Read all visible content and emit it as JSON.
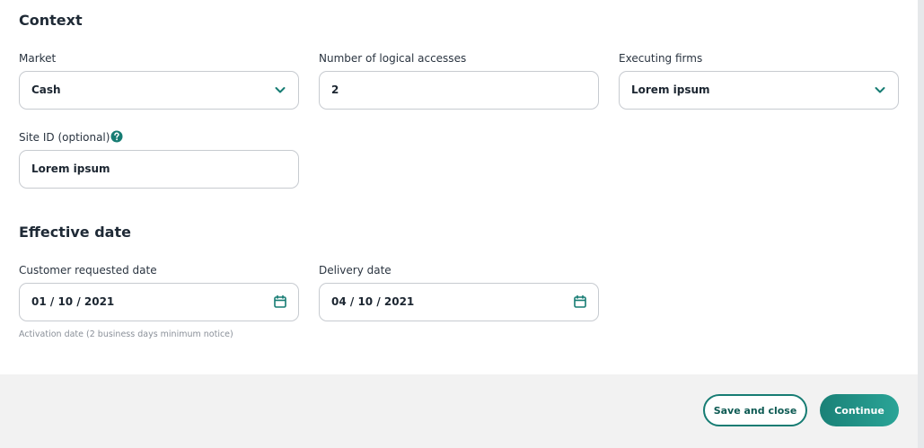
{
  "context": {
    "title": "Context",
    "market": {
      "label": "Market",
      "value": "Cash"
    },
    "logical_accesses": {
      "label": "Number of logical accesses",
      "value": "2"
    },
    "executing_firms": {
      "label": "Executing firms",
      "value": "Lorem ipsum"
    },
    "site_id": {
      "label": "Site ID (optional)",
      "value": "Lorem ipsum"
    }
  },
  "effective_date": {
    "title": "Effective date",
    "customer_requested_date": {
      "label": "Customer requested date",
      "value": "01 / 10 / 2021"
    },
    "delivery_date": {
      "label": "Delivery date",
      "value": "04 / 10 / 2021"
    },
    "hint": "Activation date (2 business days minimum notice)"
  },
  "footer": {
    "save_and_close_label": "Save and close",
    "continue_label": "Continue"
  },
  "icons": {
    "dropdown": "chevron-down-icon",
    "calendar": "calendar-icon",
    "help": "help-circle-icon"
  },
  "colors": {
    "accent": "#167c73",
    "field_border": "#c7cbd0",
    "footer_bg": "#f2f2f2"
  }
}
